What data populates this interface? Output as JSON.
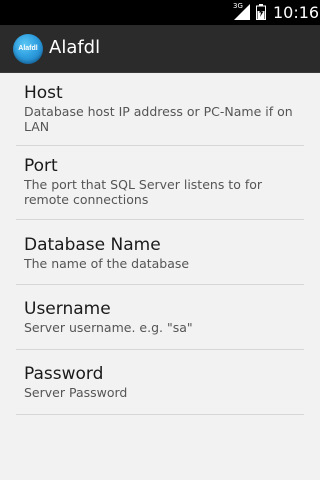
{
  "status_bar": {
    "network": "3G",
    "time": "10:16"
  },
  "action_bar": {
    "icon_text": "Alafdl",
    "title": "Alafdl"
  },
  "preferences": [
    {
      "title": "Host",
      "summary": "Database host IP address or PC-Name if on LAN"
    },
    {
      "title": "Port",
      "summary": "The port that SQL Server listens to for remote connections"
    },
    {
      "title": "Database Name",
      "summary": "The name of the database"
    },
    {
      "title": "Username",
      "summary": "Server username. e.g. \"sa\""
    },
    {
      "title": "Password",
      "summary": "Server Password"
    }
  ]
}
